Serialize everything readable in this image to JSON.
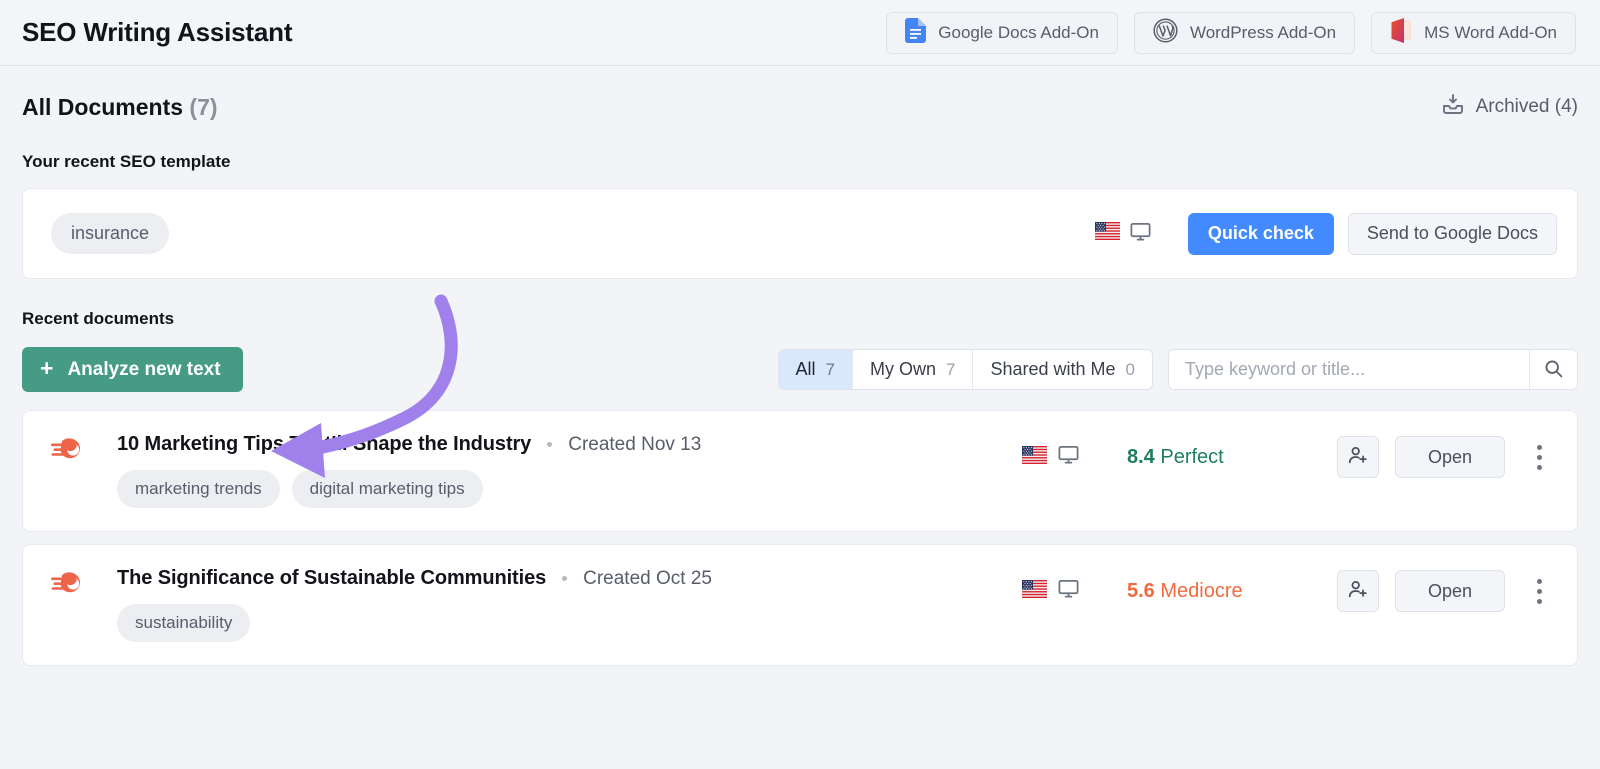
{
  "header": {
    "title": "SEO Writing Assistant",
    "addons": [
      {
        "label": "Google Docs Add-On",
        "icon": "google-docs-icon"
      },
      {
        "label": "WordPress Add-On",
        "icon": "wordpress-icon"
      },
      {
        "label": "MS Word Add-On",
        "icon": "ms-word-icon"
      }
    ]
  },
  "documents_head": {
    "title": "All Documents",
    "count": "(7)",
    "archived_label": "Archived (4)",
    "archived_icon": "archive-tray-icon"
  },
  "template_section": {
    "label": "Your recent SEO template",
    "keyword": "insurance",
    "locale_flag_icon": "us-flag-icon",
    "device_icon": "desktop-monitor-icon",
    "quick_check_label": "Quick check",
    "send_to_docs_label": "Send to Google Docs"
  },
  "recent_section": {
    "label": "Recent documents",
    "analyze_button_label": "Analyze new text",
    "analyze_button_plus": "+",
    "filters": [
      {
        "label": "All",
        "count": "7",
        "active": true
      },
      {
        "label": "My Own",
        "count": "7",
        "active": false
      },
      {
        "label": "Shared with Me",
        "count": "0",
        "active": false
      }
    ],
    "search_placeholder": "Type keyword or title...",
    "search_value": "",
    "search_icon": "search-icon"
  },
  "documents": [
    {
      "brand_icon": "semrush-comet-icon",
      "title": "10 Marketing Tips That’ll Shape the Industry",
      "created": "Created Nov 13",
      "flag_icon": "us-flag-icon",
      "device_icon": "desktop-monitor-icon",
      "score": "8.4",
      "score_label": "Perfect",
      "score_state": "perfect",
      "tags": [
        "marketing trends",
        "digital marketing tips"
      ],
      "share_icon": "add-person-icon",
      "open_label": "Open",
      "menu_icon": "kebab-menu-icon"
    },
    {
      "brand_icon": "semrush-comet-icon",
      "title": "The Significance of Sustainable Communities",
      "created": "Created Oct 25",
      "flag_icon": "us-flag-icon",
      "device_icon": "desktop-monitor-icon",
      "score": "5.6",
      "score_label": "Mediocre",
      "score_state": "mediocre",
      "tags": [
        "sustainability"
      ],
      "share_icon": "add-person-icon",
      "open_label": "Open",
      "menu_icon": "kebab-menu-icon"
    }
  ],
  "annotation": {
    "shape": "curved-arrow-pointing-left",
    "color": "#a081ec",
    "target": "analyze-new-text-button"
  },
  "colors": {
    "accent_blue": "#448aff",
    "accent_green": "#469b84",
    "score_perfect": "#1d7f5e",
    "score_mediocre": "#ef6b3f",
    "annotation_purple": "#a081ec",
    "page_background": "#f2f4f7"
  }
}
